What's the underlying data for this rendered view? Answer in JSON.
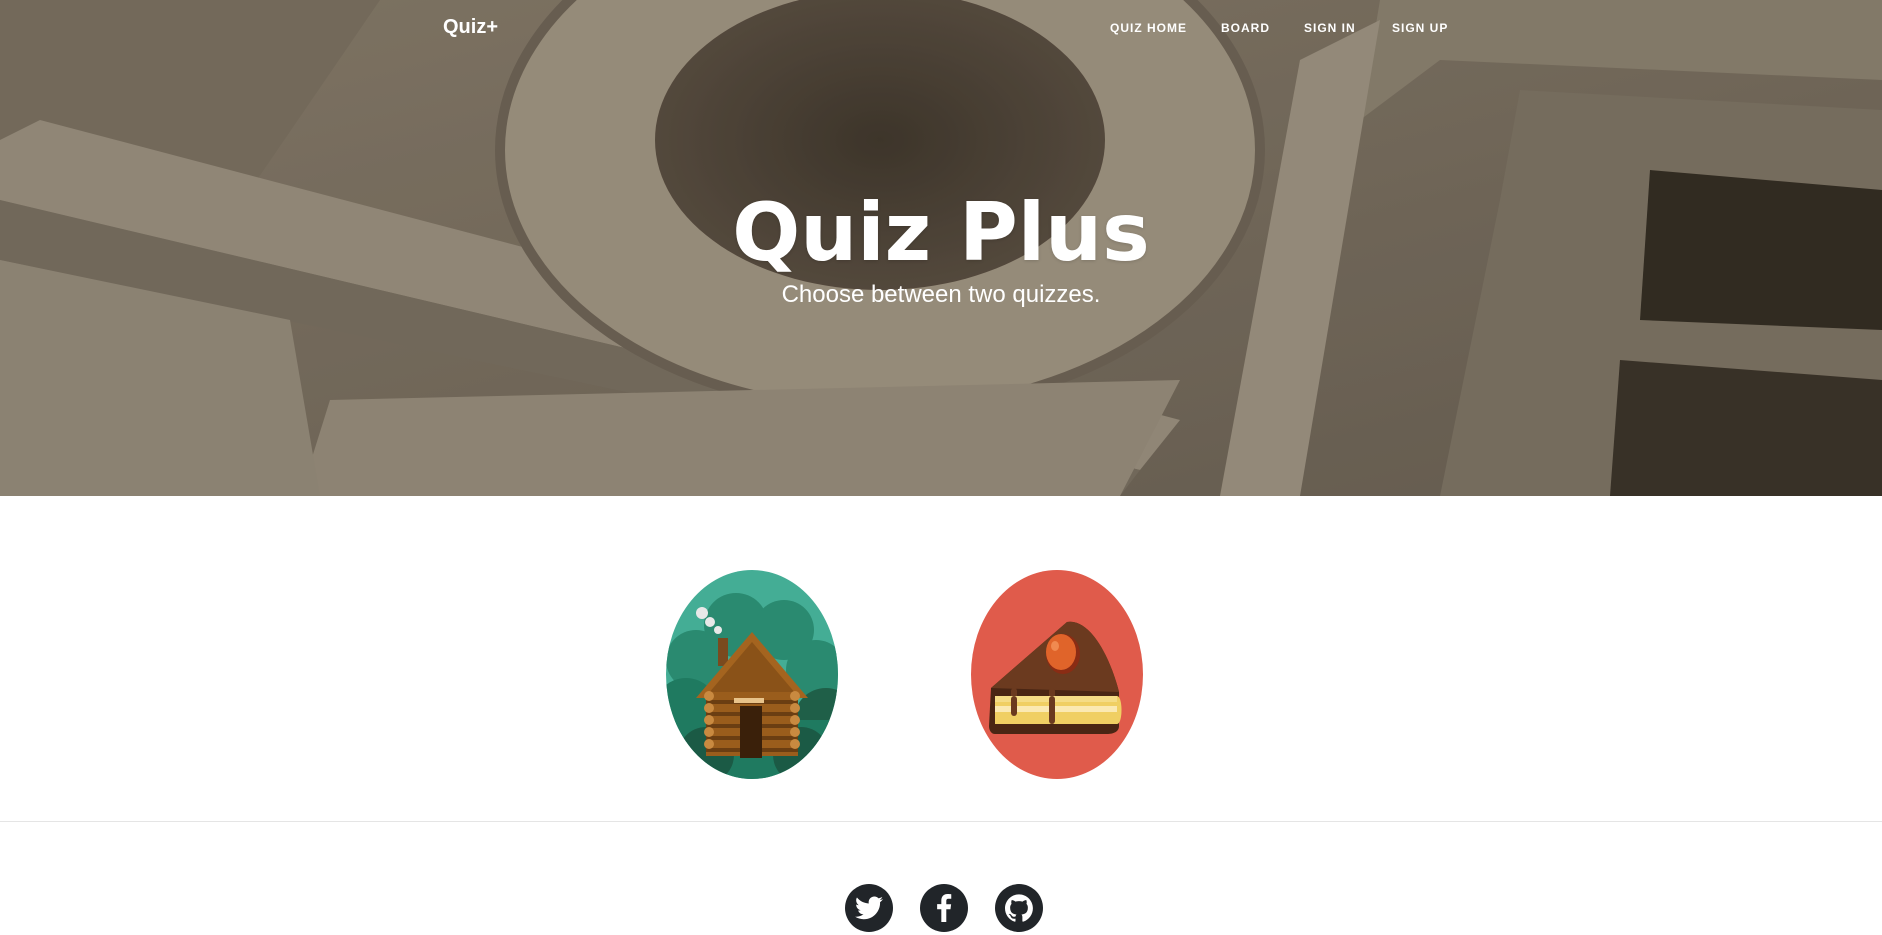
{
  "navbar": {
    "brand": "Quiz+",
    "links": [
      {
        "label": "QUIZ HOME"
      },
      {
        "label": "BOARD"
      },
      {
        "label": "SIGN IN"
      },
      {
        "label": "SIGN UP"
      }
    ]
  },
  "hero": {
    "title": "Quiz Plus",
    "subtitle": "Choose between two quizzes.",
    "background_image": "wooden-letters-photo"
  },
  "quizzes": [
    {
      "icon": "log-cabin-icon",
      "color": "#44ad95"
    },
    {
      "icon": "cake-slice-icon",
      "color": "#e05b4b"
    }
  ],
  "footer": {
    "social": [
      {
        "icon": "twitter-icon"
      },
      {
        "icon": "facebook-icon"
      },
      {
        "icon": "github-icon"
      }
    ],
    "social_bg": "#212529"
  }
}
